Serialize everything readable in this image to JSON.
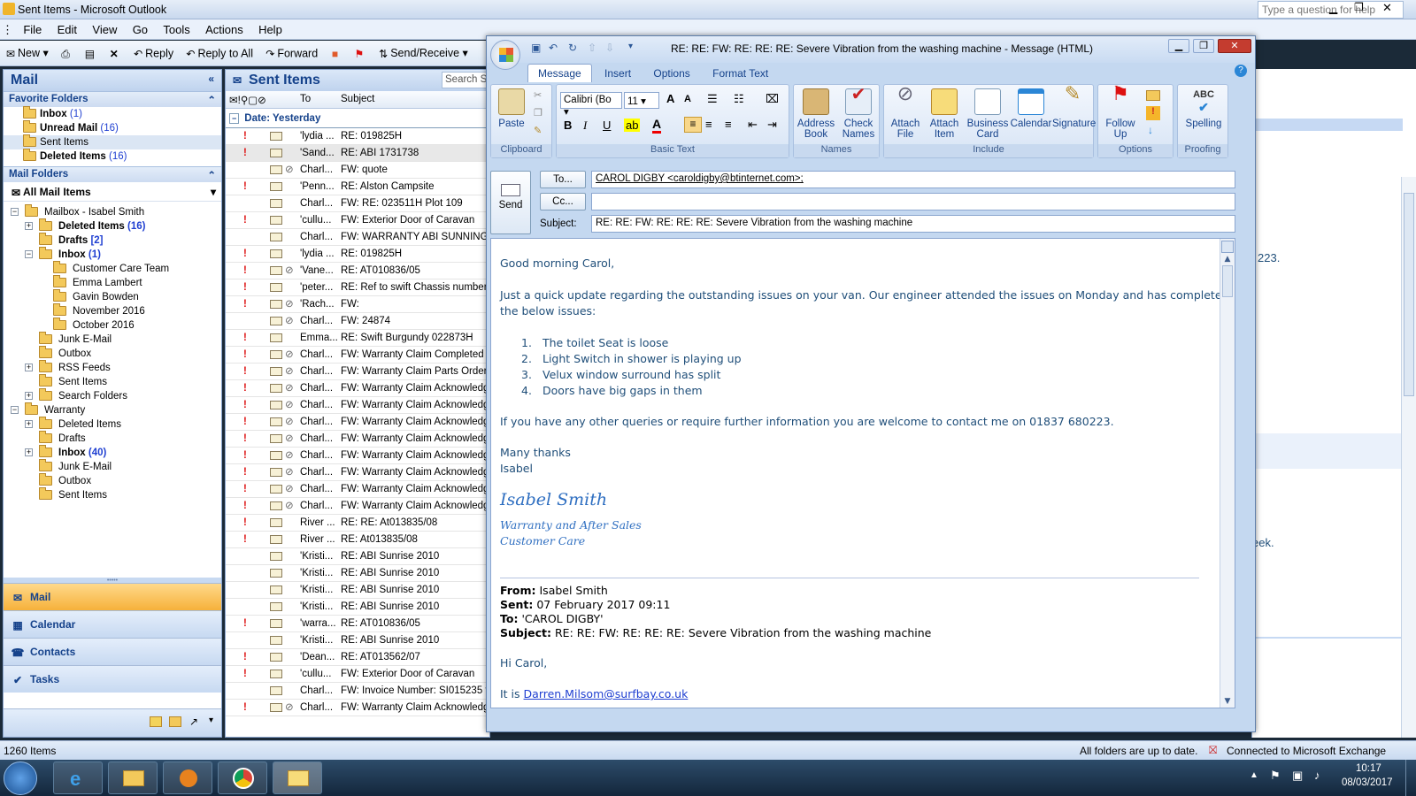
{
  "window": {
    "title": "Sent Items - Microsoft Outlook",
    "help_placeholder": "Type a question for help"
  },
  "menu": [
    "File",
    "Edit",
    "View",
    "Go",
    "Tools",
    "Actions",
    "Help"
  ],
  "toolbar": {
    "new": "New",
    "reply": "Reply",
    "reply_all": "Reply to All",
    "forward": "Forward",
    "send_receive": "Send/Receive"
  },
  "nav": {
    "title": "Mail",
    "favorites_header": "Favorite Folders",
    "favorites": [
      {
        "label": "Inbox",
        "count": "(1)",
        "bold": true
      },
      {
        "label": "Unread Mail",
        "count": "(16)",
        "bold": true
      },
      {
        "label": "Sent Items",
        "count": "",
        "bold": false
      },
      {
        "label": "Deleted Items",
        "count": "(16)",
        "bold": true
      }
    ],
    "mail_folders_header": "Mail Folders",
    "all_mail": "All Mail Items",
    "tree": [
      {
        "label": "Mailbox - Isabel Smith",
        "count": "",
        "level": 0,
        "expander": "−"
      },
      {
        "label": "Deleted Items",
        "count": "(16)",
        "level": 1,
        "expander": "+",
        "bold": true
      },
      {
        "label": "Drafts",
        "count": "[2]",
        "level": 1,
        "expander": "",
        "bold": true
      },
      {
        "label": "Inbox",
        "count": "(1)",
        "level": 1,
        "expander": "−",
        "bold": true
      },
      {
        "label": "Customer Care Team",
        "count": "",
        "level": 2,
        "expander": ""
      },
      {
        "label": "Emma Lambert",
        "count": "",
        "level": 2,
        "expander": ""
      },
      {
        "label": "Gavin Bowden",
        "count": "",
        "level": 2,
        "expander": ""
      },
      {
        "label": "November 2016",
        "count": "",
        "level": 2,
        "expander": ""
      },
      {
        "label": "October 2016",
        "count": "",
        "level": 2,
        "expander": ""
      },
      {
        "label": "Junk E-Mail",
        "count": "",
        "level": 1,
        "expander": ""
      },
      {
        "label": "Outbox",
        "count": "",
        "level": 1,
        "expander": ""
      },
      {
        "label": "RSS Feeds",
        "count": "",
        "level": 1,
        "expander": "+"
      },
      {
        "label": "Sent Items",
        "count": "",
        "level": 1,
        "expander": ""
      },
      {
        "label": "Search Folders",
        "count": "",
        "level": 1,
        "expander": "+"
      },
      {
        "label": "Warranty",
        "count": "",
        "level": 0,
        "expander": "−"
      },
      {
        "label": "Deleted Items",
        "count": "",
        "level": 1,
        "expander": "+"
      },
      {
        "label": "Drafts",
        "count": "",
        "level": 1,
        "expander": ""
      },
      {
        "label": "Inbox",
        "count": "(40)",
        "level": 1,
        "expander": "+",
        "bold": true
      },
      {
        "label": "Junk E-Mail",
        "count": "",
        "level": 1,
        "expander": ""
      },
      {
        "label": "Outbox",
        "count": "",
        "level": 1,
        "expander": ""
      },
      {
        "label": "Sent Items",
        "count": "",
        "level": 1,
        "expander": ""
      }
    ],
    "buttons": [
      "Mail",
      "Calendar",
      "Contacts",
      "Tasks"
    ]
  },
  "list": {
    "title": "Sent Items",
    "search_placeholder": "Search Se",
    "col_to": "To",
    "col_subject": "Subject",
    "group": "Date: Yesterday",
    "rows": [
      {
        "imp": true,
        "clip": false,
        "from": "'lydia ...",
        "subject": "RE: 019825H"
      },
      {
        "imp": true,
        "clip": false,
        "from": "'Sand...",
        "subject": "RE: ABI 1731738"
      },
      {
        "imp": false,
        "clip": true,
        "from": "Charl...",
        "subject": "FW: quote"
      },
      {
        "imp": true,
        "clip": false,
        "from": "'Penn...",
        "subject": "RE: Alston Campsite"
      },
      {
        "imp": false,
        "clip": false,
        "from": "Charl...",
        "subject": "FW: RE: 023511H Plot 109"
      },
      {
        "imp": true,
        "clip": false,
        "from": "'cullu...",
        "subject": "FW: Exterior Door of Caravan"
      },
      {
        "imp": false,
        "clip": false,
        "from": "Charl...",
        "subject": "FW: WARRANTY ABI SUNNINGDA"
      },
      {
        "imp": true,
        "clip": false,
        "from": "'lydia ...",
        "subject": "RE: 019825H"
      },
      {
        "imp": true,
        "clip": true,
        "from": "'Vane...",
        "subject": "RE: AT010836/05"
      },
      {
        "imp": true,
        "clip": false,
        "from": "'peter...",
        "subject": "RE: Ref to swift Chassis number"
      },
      {
        "imp": true,
        "clip": true,
        "from": "'Rach...",
        "subject": "FW:"
      },
      {
        "imp": false,
        "clip": true,
        "from": "Charl...",
        "subject": "FW: 24874"
      },
      {
        "imp": true,
        "clip": false,
        "from": "Emma...",
        "subject": "RE: Swift Burgundy 022873H"
      },
      {
        "imp": true,
        "clip": true,
        "from": "Charl...",
        "subject": "FW: Warranty Claim Completed"
      },
      {
        "imp": true,
        "clip": true,
        "from": "Charl...",
        "subject": "FW: Warranty Claim Parts Ordere"
      },
      {
        "imp": true,
        "clip": true,
        "from": "Charl...",
        "subject": "FW: Warranty Claim Acknowledg"
      },
      {
        "imp": true,
        "clip": true,
        "from": "Charl...",
        "subject": "FW: Warranty Claim Acknowledg"
      },
      {
        "imp": true,
        "clip": true,
        "from": "Charl...",
        "subject": "FW: Warranty Claim Acknowledg"
      },
      {
        "imp": true,
        "clip": true,
        "from": "Charl...",
        "subject": "FW: Warranty Claim Acknowledg"
      },
      {
        "imp": true,
        "clip": true,
        "from": "Charl...",
        "subject": "FW: Warranty Claim Acknowledg"
      },
      {
        "imp": true,
        "clip": true,
        "from": "Charl...",
        "subject": "FW: Warranty Claim Acknowledg"
      },
      {
        "imp": true,
        "clip": true,
        "from": "Charl...",
        "subject": "FW: Warranty Claim Acknowledg"
      },
      {
        "imp": true,
        "clip": true,
        "from": "Charl...",
        "subject": "FW: Warranty Claim Acknowledg"
      },
      {
        "imp": true,
        "clip": false,
        "from": "River ...",
        "subject": "RE: RE: At013835/08"
      },
      {
        "imp": true,
        "clip": false,
        "from": "River ...",
        "subject": "RE: At013835/08"
      },
      {
        "imp": false,
        "clip": false,
        "from": "'Kristi...",
        "subject": "RE: ABI Sunrise 2010"
      },
      {
        "imp": false,
        "clip": false,
        "from": "'Kristi...",
        "subject": "RE: ABI Sunrise 2010"
      },
      {
        "imp": false,
        "clip": false,
        "from": "'Kristi...",
        "subject": "RE: ABI Sunrise 2010"
      },
      {
        "imp": false,
        "clip": false,
        "from": "'Kristi...",
        "subject": "RE: ABI Sunrise 2010"
      },
      {
        "imp": true,
        "clip": false,
        "from": "'warra...",
        "subject": "RE: AT010836/05"
      },
      {
        "imp": false,
        "clip": false,
        "from": "'Kristi...",
        "subject": "RE: ABI Sunrise 2010"
      },
      {
        "imp": true,
        "clip": false,
        "from": "'Dean...",
        "subject": "RE: AT013562/07"
      },
      {
        "imp": true,
        "clip": false,
        "from": "'cullu...",
        "subject": "FW: Exterior Door of Caravan"
      },
      {
        "imp": false,
        "clip": false,
        "from": "Charl...",
        "subject": "FW: Invoice Number: SI015235 fo"
      },
      {
        "imp": true,
        "clip": true,
        "from": "Charl...",
        "subject": "FW: Warranty Claim Acknowledg"
      }
    ]
  },
  "reading_fragments": {
    "phone_tail": "223.",
    "week_tail": "eek."
  },
  "status": {
    "items": "1260 Items",
    "folders": "All folders are up to date.",
    "connection": "Connected to Microsoft Exchange"
  },
  "taskbar": {
    "time": "10:17",
    "date": "08/03/2017"
  },
  "message": {
    "title": "RE: RE: FW: RE: RE: RE: Severe Vibration from the washing machine - Message (HTML)",
    "tabs": [
      "Message",
      "Insert",
      "Options",
      "Format Text"
    ],
    "ribbon": {
      "paste": "Paste",
      "clipboard": "Clipboard",
      "font": "Calibri (Bo",
      "size": "11",
      "basic_text": "Basic Text",
      "address_book": "Address Book",
      "check_names": "Check Names",
      "names": "Names",
      "attach_file": "Attach File",
      "attach_item": "Attach Item",
      "business_card": "Business Card",
      "calendar": "Calendar",
      "signature": "Signature",
      "include": "Include",
      "follow_up": "Follow Up",
      "options": "Options",
      "spelling": "Spelling",
      "proofing": "Proofing"
    },
    "send": "Send",
    "to_btn": "To...",
    "cc_btn": "Cc...",
    "subject_label": "Subject:",
    "to_value": "CAROL DIGBY <caroldigby@btinternet.com>;",
    "cc_value": "",
    "subject_value": "RE: RE: FW: RE: RE: RE: Severe Vibration from the washing machine",
    "body": {
      "greeting": "Good morning Carol,",
      "para1a": "Just a quick update regarding the outstanding issues on your van. Our engineer attended the issues on Monday and has completed",
      "para1b": "the below issues:",
      "items": [
        "The toilet Seat is loose",
        "Light Switch in shower is playing up",
        "Velux window surround has split",
        "Doors have big gaps in them"
      ],
      "para2": "If you have any other queries or require further information you are welcome to contact me on 01837 680223.",
      "thanks": "Many thanks",
      "name": "Isabel",
      "sig_name": "Isabel Smith",
      "sig_line1": "Warranty and After Sales",
      "sig_line2": "Customer Care",
      "from_label": "From:",
      "from_value": "Isabel Smith",
      "sent_label": "Sent:",
      "sent_value": "07 February 2017 09:11",
      "to_label": "To:",
      "to_value": "'CAROL DIGBY'",
      "subj_label": "Subject:",
      "subj_value": "RE: RE: FW: RE: RE: RE: Severe Vibration from the washing machine",
      "hi": "Hi Carol,",
      "it_is": "It is ",
      "link": "Darren.Milsom@surfbay.co.uk"
    }
  }
}
